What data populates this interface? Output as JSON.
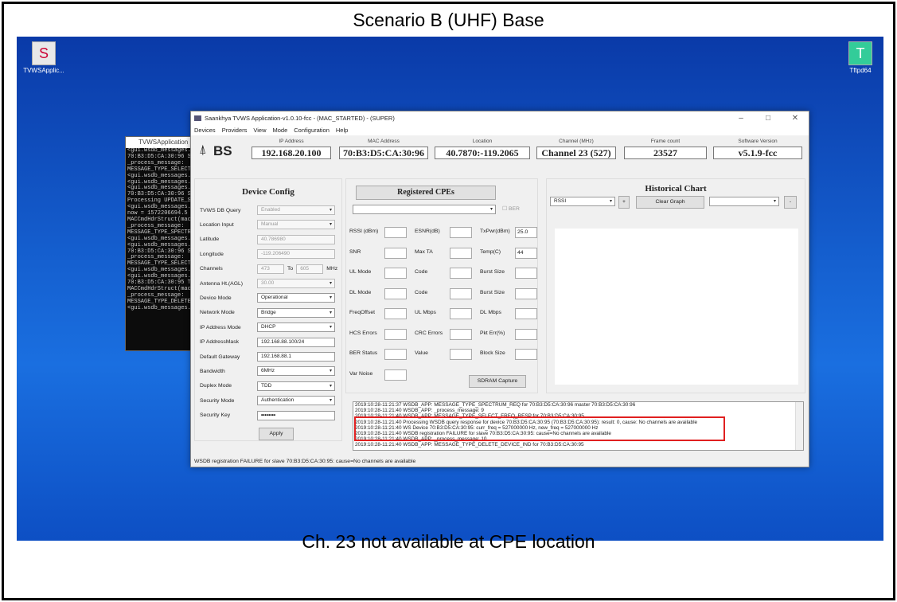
{
  "slide": {
    "title": "Scenario B (UHF) Base",
    "caption": "Ch. 23 not available at CPE location"
  },
  "desktop_icons": {
    "left": "TVWSApplic...",
    "right": "Tftpd64"
  },
  "console": {
    "title": "TVWSApplication",
    "lines": [
      "<gui.wsdb_messages.",
      "70:B3:D5:CA:30:96 S",
      "_process_message:",
      "MESSAGE_TYPE_SELECT",
      "<gui.wsdb_messages.",
      "<gui.wsdb_messages.",
      "<gui.wsdb_messages.",
      "70:B3:D5:CA:30:96 S",
      "Processing UPDATE_S",
      "<gui.wsdb_messages.",
      "now = 1572206694.5",
      "MACCmdHdrStruct(mac",
      "_process_message:",
      "MESSAGE_TYPE_SPECTR",
      "<gui.wsdb_messages.",
      "<gui.wsdb_messages.",
      "70:B3:D5:CA:30:96 S",
      "_process_message:",
      "MESSAGE_TYPE_SELECT",
      "<gui.wsdb_messages.",
      "<gui.wsdb_messages.",
      "70:B3:D5:CA:30:95 T",
      "MACCmdHdrStruct(mac",
      "_process_message:",
      "MESSAGE_TYPE_DELETE",
      "<gui.wsdb_messages."
    ]
  },
  "window": {
    "title": "Saankhya TVWS Application-v1.0.10-fcc - (MAC_STARTED) - (SUPER)",
    "menu": [
      "Devices",
      "Providers",
      "View",
      "Mode",
      "Configuration",
      "Help"
    ]
  },
  "info": {
    "logo": "BS",
    "ip_label": "IP Address",
    "ip": "192.168.20.100",
    "mac_label": "MAC Address",
    "mac": "70:B3:D5:CA:30:96",
    "loc_label": "Location",
    "loc": "40.7870:-119.2065",
    "ch_label": "Channel (MHz)",
    "ch": "Channel 23 (527)",
    "fc_label": "Frame count",
    "fc": "23527",
    "sw_label": "Software Version",
    "sw": "v5.1.9-fcc"
  },
  "device_config": {
    "title": "Device Config",
    "rows": [
      {
        "label": "TVWS DB Query",
        "value": "Enabled"
      },
      {
        "label": "Location Input",
        "value": "Manual"
      },
      {
        "label": "Latitude",
        "value": "40.786980"
      },
      {
        "label": "Longitude",
        "value": "-119.206490"
      },
      {
        "label": "Channels",
        "value": "473",
        "to": "To",
        "value2": "605",
        "unit": "MHz"
      },
      {
        "label": "Antenna Ht.(AGL)",
        "value": "30.00"
      },
      {
        "label": "Device Mode",
        "value": "Operational"
      },
      {
        "label": "Network Mode",
        "value": "Bridge"
      },
      {
        "label": "IP Address Mode",
        "value": "DHCP"
      },
      {
        "label": "IP AddressMask",
        "value": "192.168.88.100/24"
      },
      {
        "label": "Default Gateway",
        "value": "192.168.88.1"
      },
      {
        "label": "Bandwidth",
        "value": "6MHz"
      },
      {
        "label": "Duplex Mode",
        "value": "TDD"
      },
      {
        "label": "Security Mode",
        "value": "Authentication"
      },
      {
        "label": "Security Key",
        "value": "••••••••"
      }
    ],
    "apply": "Apply"
  },
  "cpes": {
    "title": "Registered CPEs",
    "ber": "BER",
    "rssi": "RSSI (dBm)",
    "esnr": "ESNR(dB)",
    "txpwr": "TxPwr(dBm)",
    "txpwr_val": "25.0",
    "snr": "SNR",
    "maxta": "Max TA",
    "temp": "Temp(C)",
    "temp_val": "44",
    "ulmode": "UL Mode",
    "code1": "Code",
    "burst1": "Burst Size",
    "dlmode": "DL Mode",
    "code2": "Code",
    "burst2": "Burst Size",
    "freq": "FreqOffset",
    "ulmbps": "UL Mbps",
    "dlmbps": "DL Mbps",
    "hcs": "HCS Errors",
    "crc": "CRC Errors",
    "pkt": "Pkt Err(%)",
    "berstat": "BER Status",
    "value": "Value",
    "block": "Block Size",
    "varnoise": "Var Noise",
    "sdram": "SDRAM Capture"
  },
  "chart": {
    "title": "Historical Chart",
    "select": "RSSI",
    "plus": "+",
    "clear": "Clear Graph",
    "minus": "-"
  },
  "log": {
    "lines": [
      "2019:10:28-11:21:37 WSDB_APP: MESSAGE_TYPE_SPECTRUM_REQ for 70:B3:D5:CA:30:96 master 70:B3:D5:CA:30:96",
      "2019:10:28-11:21:40 WSDB_APP: _process_message: 9",
      "2019:10:28-11:21:40 WSDB_APP: MESSAGE_TYPE_SELECT_FREQ_RESP for 70:B3:D5:CA:30:95",
      "2019:10:28-11:21:40 Processing WSDB query response for device 70:B3:D5:CA:30:95 (70:B3:D5:CA:30:95): result: 0, cause: No channels are available",
      "2019:10:28-11:21:40 WS Device 70:B3:D5:CA:30:95: curr_freq = 527000000 Hz, new_freq = 527000000 Hz",
      "2019:10:28-11:21:40 WSDB registration FAILURE for slave 70:B3:D5:CA:30:95: cause=No channels are available",
      "2019:10:28-11:21:40 WSDB_APP: _process_message: 10",
      "2019:10:28-11:21:40 WSDB_APP: MESSAGE_TYPE_DELETE_DEVICE_IND for 70:B3:D5:CA:30:95"
    ]
  },
  "status": "WSDB registration FAILURE for slave 70:B3:D5:CA:30:95: cause=No channels are available"
}
